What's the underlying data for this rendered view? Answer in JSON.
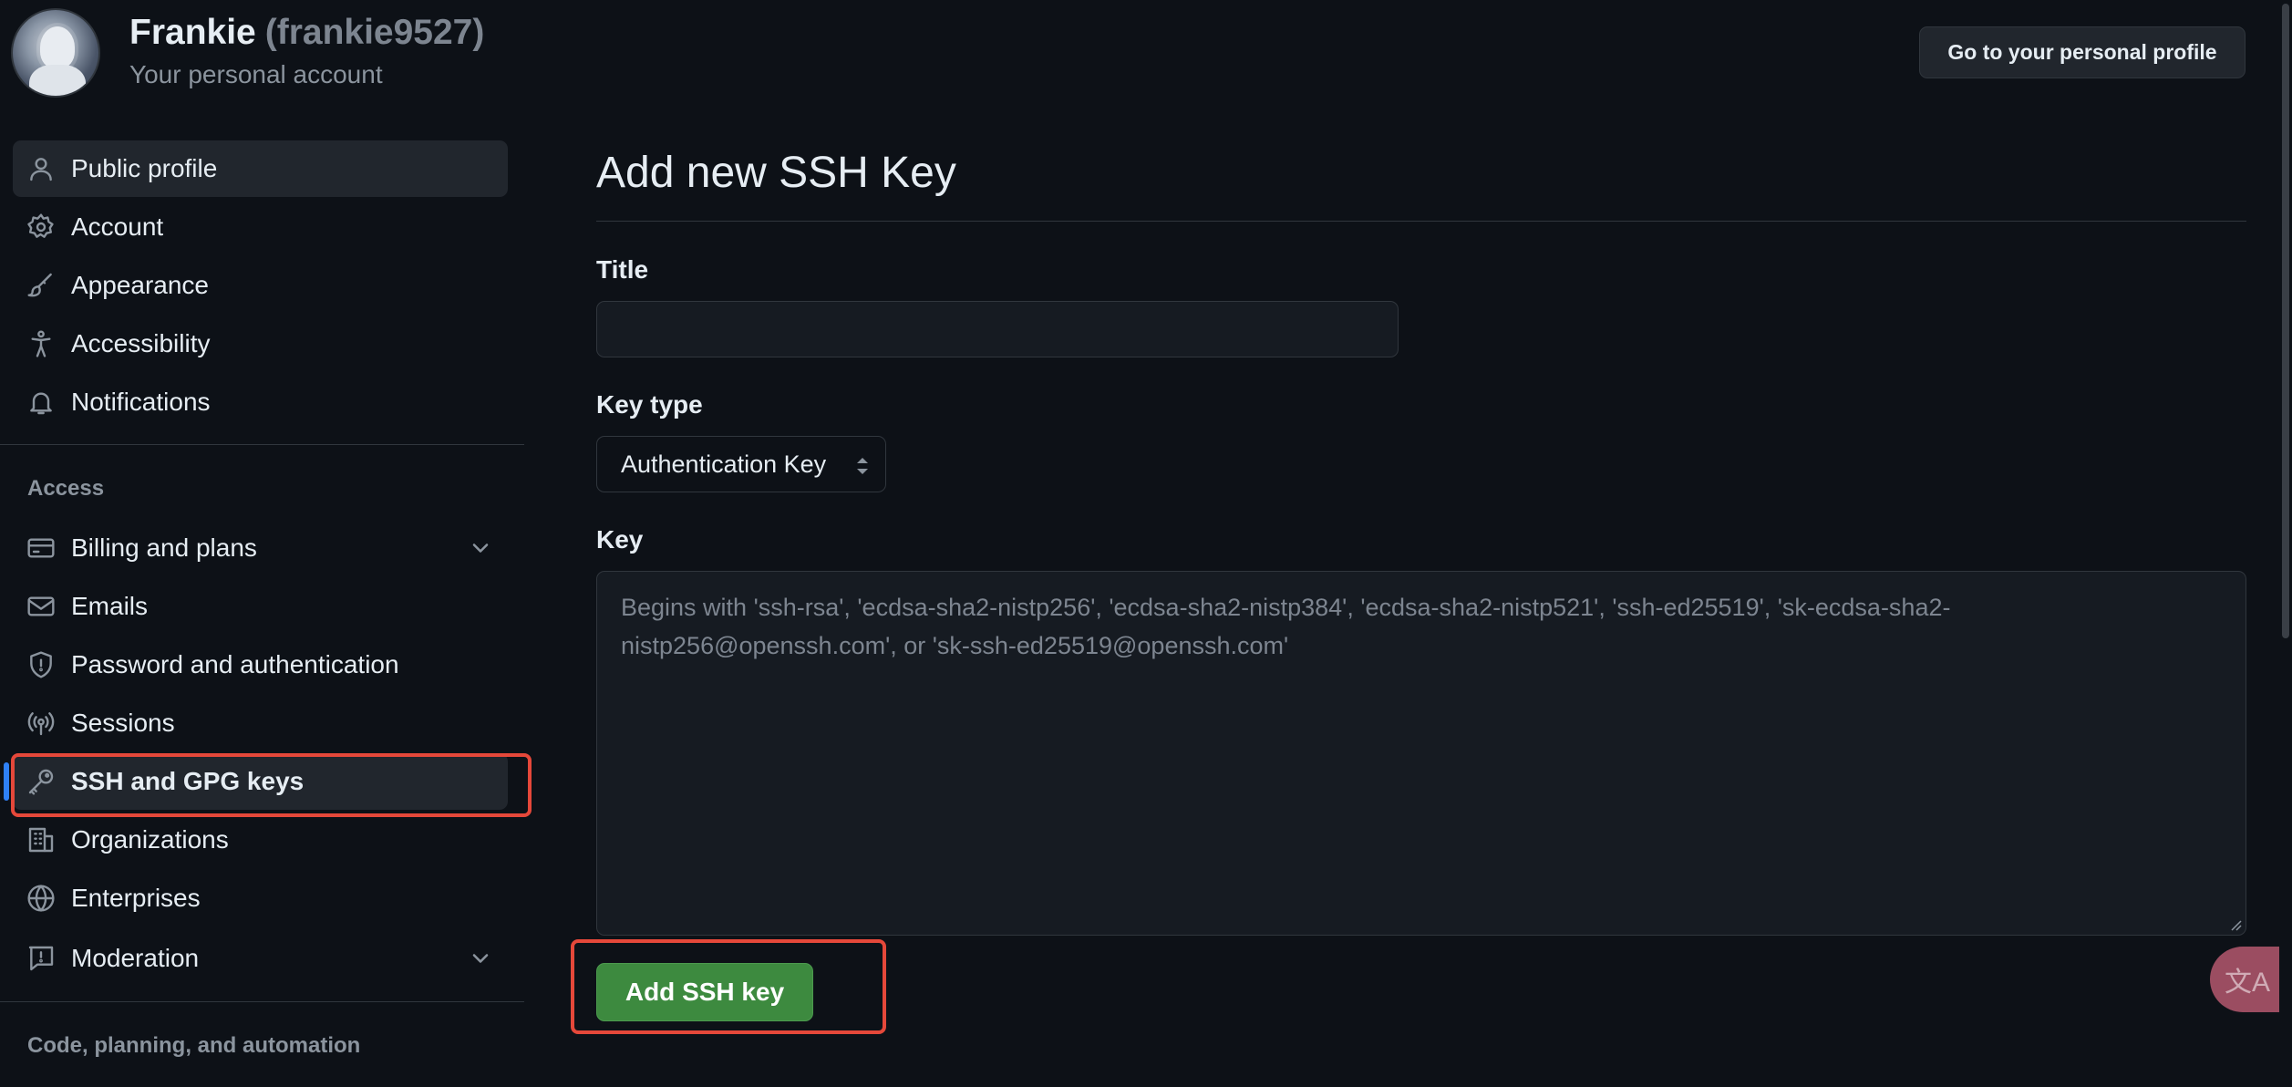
{
  "header": {
    "display_name": "Frankie",
    "handle": "(frankie9527)",
    "subtitle": "Your personal account",
    "profile_button": "Go to your personal profile"
  },
  "sidebar": {
    "items": [
      {
        "label": "Public profile",
        "icon": "person-icon"
      },
      {
        "label": "Account",
        "icon": "gear-icon"
      },
      {
        "label": "Appearance",
        "icon": "paintbrush-icon"
      },
      {
        "label": "Accessibility",
        "icon": "accessibility-icon"
      },
      {
        "label": "Notifications",
        "icon": "bell-icon"
      }
    ],
    "access_heading": "Access",
    "access_items": [
      {
        "label": "Billing and plans",
        "icon": "credit-card-icon"
      },
      {
        "label": "Emails",
        "icon": "mail-icon"
      },
      {
        "label": "Password and authentication",
        "icon": "shield-icon"
      },
      {
        "label": "Sessions",
        "icon": "broadcast-icon"
      },
      {
        "label": "SSH and GPG keys",
        "icon": "key-icon"
      },
      {
        "label": "Organizations",
        "icon": "organization-icon"
      },
      {
        "label": "Enterprises",
        "icon": "globe-icon"
      },
      {
        "label": "Moderation",
        "icon": "report-icon"
      }
    ],
    "code_heading": "Code, planning, and automation"
  },
  "main": {
    "title": "Add new SSH Key",
    "title_label": "Title",
    "title_value": "",
    "key_type_label": "Key type",
    "key_type_value": "Authentication Key",
    "key_label": "Key",
    "key_placeholder": "Begins with 'ssh-rsa', 'ecdsa-sha2-nistp256', 'ecdsa-sha2-nistp384', 'ecdsa-sha2-nistp521', 'ssh-ed25519', 'sk-ecdsa-sha2-nistp256@openssh.com', or 'sk-ssh-ed25519@openssh.com'",
    "submit_label": "Add SSH key"
  },
  "colors": {
    "background": "#0d1117",
    "accent_blue": "#2f81f7",
    "primary_green": "#3d8a3f",
    "annotation_red": "#e5483a"
  },
  "extras": {
    "translate_icon": "translate-icon",
    "translate_glyph": "文A"
  }
}
